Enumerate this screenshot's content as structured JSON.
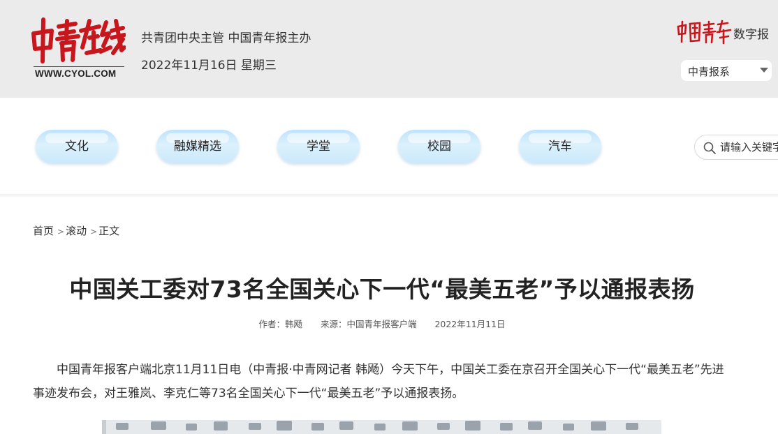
{
  "header": {
    "logo_url_text": "WWW.CYOL.COM",
    "org_text": "共青团中央主管 中国青年报主办",
    "date_text": "2022年11月16日 星期三",
    "digital_label": "数字报",
    "paper_select": {
      "value": "中青报系"
    }
  },
  "nav": {
    "items": [
      {
        "label": "文化"
      },
      {
        "label": "融媒精选"
      },
      {
        "label": "学堂"
      },
      {
        "label": "校园"
      },
      {
        "label": "汽车"
      }
    ],
    "search_placeholder": "请输入关键字"
  },
  "breadcrumb": {
    "home": "首页",
    "sep1": ">",
    "section": "滚动",
    "sep2": ">",
    "current": "正文"
  },
  "article": {
    "title": "中国关工委对73名全国关心下一代“最美五老”予以通报表扬",
    "author": "作者：韩飏",
    "source": "来源：中国青年报客户端",
    "date": "2022年11月11日",
    "paragraph": "中国青年报客户端北京11月11日电（中青报·中青网记者 韩飏）今天下午，中国关工委在京召开全国关心下一代“最美五老”先进事迹发布会，对王雅岚、李克仁等73名全国关心下一代“最美五老”予以通报表扬。"
  },
  "colors": {
    "brand_red": "#c8161d",
    "header_bg": "#ebebeb",
    "pill_blue": "#cde9fb"
  }
}
